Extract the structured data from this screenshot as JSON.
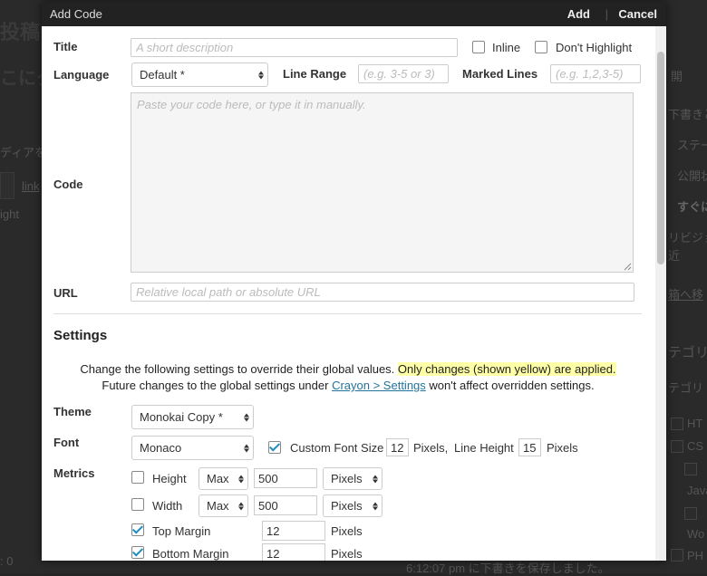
{
  "background": {
    "title_fragment": "投稿",
    "subtitle_fragment": "こにタ",
    "media_fragment": "ディアを",
    "link_fragment": "link",
    "tab_fragment": "ight",
    "right_items": [
      "開",
      "下書きと",
      "ステー",
      "公開状",
      "すぐに",
      "リビジョ",
      "近",
      "箱へ移",
      "テゴリ",
      "テゴリ",
      "HT",
      "CS",
      "Java",
      "Wo",
      "PH"
    ],
    "status_text": "6:12:07 pm に下書きを保存しました。",
    "left_status": ": 0"
  },
  "modal": {
    "title": "Add Code",
    "add_label": "Add",
    "separator": "|",
    "cancel_label": "Cancel"
  },
  "form": {
    "title_label": "Title",
    "title_placeholder": "A short description",
    "inline_label": "Inline",
    "dont_highlight_label": "Don't Highlight",
    "language_label": "Language",
    "language_value": "Default *",
    "line_range_label": "Line Range",
    "line_range_placeholder": "(e.g. 3-5 or 3)",
    "marked_lines_label": "Marked Lines",
    "marked_lines_placeholder": "(e.g. 1,2,3-5)",
    "code_label": "Code",
    "code_placeholder": "Paste your code here, or type it in manually.",
    "url_label": "URL",
    "url_placeholder": "Relative local path or absolute URL"
  },
  "settings": {
    "title": "Settings",
    "notice_line1_a": "Change the following settings to override their global values.",
    "notice_line1_highlight": "Only changes (shown yellow) are applied.",
    "notice_line2_a": "Future changes to the global settings under",
    "notice_line2_link": "Crayon > Settings",
    "notice_line2_b": "won't affect overridden settings.",
    "theme_label": "Theme",
    "theme_value": "Monokai Copy *",
    "font_label": "Font",
    "font_value": "Monaco",
    "custom_font_size_label": "Custom Font Size",
    "font_size_value": "12",
    "pixels_comma": "Pixels,",
    "line_height_label": "Line Height",
    "line_height_value": "15",
    "pixels_label": "Pixels",
    "metrics_label": "Metrics",
    "height_label": "Height",
    "width_label": "Width",
    "max_option": "Max",
    "height_value": "500",
    "width_value": "500",
    "top_margin_label": "Top Margin",
    "top_margin_value": "12",
    "bottom_margin_label": "Bottom Margin",
    "bottom_margin_value": "12"
  }
}
